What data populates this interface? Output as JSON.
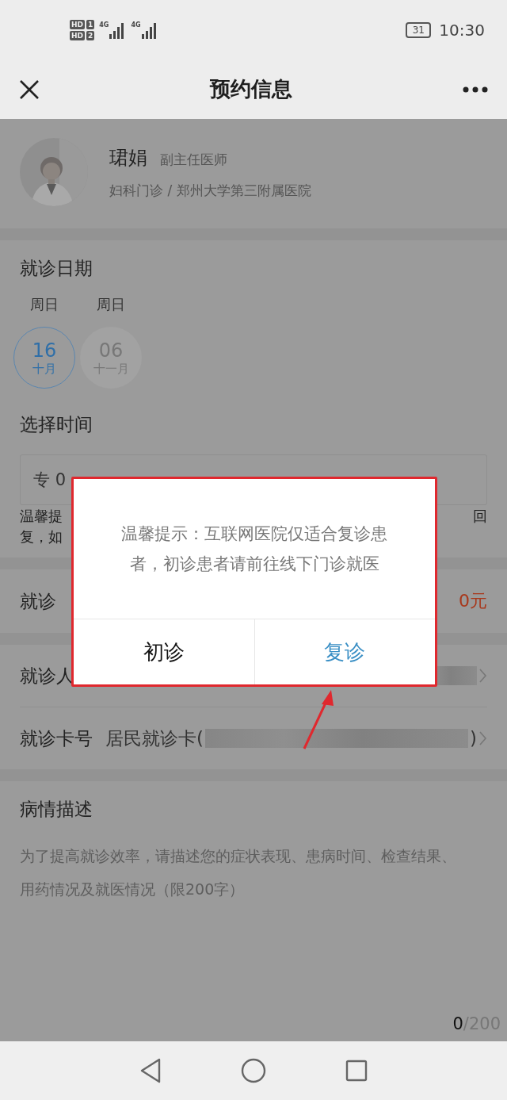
{
  "status_bar": {
    "sims": [
      {
        "hd": "HD",
        "slot": "1",
        "network": "4G"
      },
      {
        "hd": "HD",
        "slot": "2",
        "network": "4G"
      }
    ],
    "battery": "31",
    "time": "10:30"
  },
  "nav": {
    "title": "预约信息"
  },
  "doctor": {
    "name": "珺娟",
    "title": "副主任医师",
    "department": "妇科门诊 / 郑州大学第三附属医院"
  },
  "date_section": {
    "heading": "就诊日期",
    "dates": [
      {
        "weekday": "周日",
        "day": "16",
        "month": "十月",
        "selected": true
      },
      {
        "weekday": "周日",
        "day": "06",
        "month": "十一月",
        "selected": false
      }
    ]
  },
  "time_section": {
    "heading": "选择时间",
    "slot_visible": "专 0",
    "tip_lines": [
      {
        "left": "温馨提",
        "right": "回"
      },
      {
        "left": "复，如"
      }
    ]
  },
  "fee": {
    "label_visible": "就诊",
    "value": "0元"
  },
  "patient": {
    "label": "就诊人",
    "value_redacted": true
  },
  "card": {
    "label": "就诊卡号",
    "prefix": "居民就诊卡(",
    "value_redacted": true,
    "suffix": ")"
  },
  "description": {
    "heading": "病情描述",
    "placeholder": "为了提高就诊效率，请描述您的症状表现、患病时间、检查结果、用药情况及就医情况（限200字）",
    "count": "0",
    "limit": "/200"
  },
  "dialog": {
    "message": "温馨提示：互联网医院仅适合复诊患者，初诊患者请前往线下门诊就医",
    "buttons": [
      {
        "label": "初诊",
        "primary": false
      },
      {
        "label": "复诊",
        "primary": true
      }
    ],
    "highlighted": true,
    "arrow": true
  }
}
